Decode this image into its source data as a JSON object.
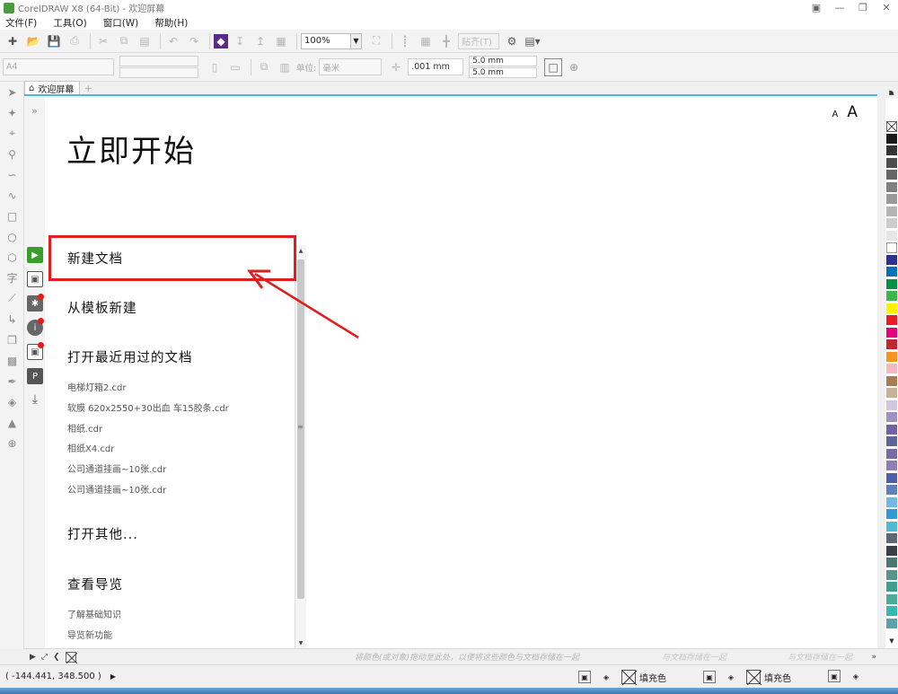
{
  "window": {
    "title": "CorelDRAW X8 (64-Bit) - 欢迎屏幕"
  },
  "menu": [
    "文件(F)",
    "工具(O)",
    "窗口(W)",
    "帮助(H)"
  ],
  "toolbar": {
    "zoom_value": "100%",
    "snap_label": "贴齐(T)"
  },
  "property_bar": {
    "page_size": "A4",
    "units_label": "单位:",
    "units_value": "毫米",
    "nudge_value": ".001 mm",
    "dup_x": "5.0 mm",
    "dup_y": "5.0 mm"
  },
  "tabs": [
    {
      "label": "欢迎屏幕"
    }
  ],
  "welcome": {
    "heading": "立即开始",
    "font_small": "A",
    "font_large": "A",
    "items": {
      "new_doc": "新建文档",
      "from_template": "从模板新建",
      "open_recent": "打开最近用过的文档",
      "open_other": "打开其他...",
      "tour": "查看导览"
    },
    "recent_files": [
      "电梯灯箱2.cdr",
      "软膜 620x2550+30出血 车15胶条.cdr",
      "相纸.cdr",
      "相纸X4.cdr",
      "公司通道挂画~10张.cdr",
      "公司通道挂画~10张.cdr"
    ],
    "tour_links": [
      "了解基础知识",
      "导览新功能"
    ]
  },
  "navbar": {
    "hint": "将颜色(或对象)拖动至此处，以便将这些颜色与文档存储在一起",
    "hint_fragment": "与文档存储在一起"
  },
  "status": {
    "coords": "( -144.441, 348.500 )",
    "fill_label": "填充色"
  },
  "colors": {
    "accent_red": "#e01e1e",
    "tab_underline": "#5aaee0",
    "palette": [
      "#ffffff",
      "#1a1a1a",
      "#333333",
      "#4d4d4d",
      "#666666",
      "#808080",
      "#999999",
      "#b3b3b3",
      "#cccccc",
      "#e6e6e6",
      "#ffffff",
      "#2e3192",
      "#0071bc",
      "#009245",
      "#39b54a",
      "#fff200",
      "#ed1c24",
      "#e6007e",
      "#c1272d",
      "#f7931e",
      "#f4b8c0",
      "#a67c52",
      "#c7b299",
      "#cfc7e0",
      "#9e91c4",
      "#6f63a5",
      "#5b6599",
      "#756ba8",
      "#8c7fb8",
      "#4f5fa8",
      "#5b7fbf",
      "#6fb8e8",
      "#2e9bd6",
      "#4dbbd4",
      "#606670",
      "#3a3f47",
      "#4a7873",
      "#56958a",
      "#3e9f8a",
      "#4bab9a",
      "#37b6b2",
      "#5aa0ad"
    ]
  }
}
